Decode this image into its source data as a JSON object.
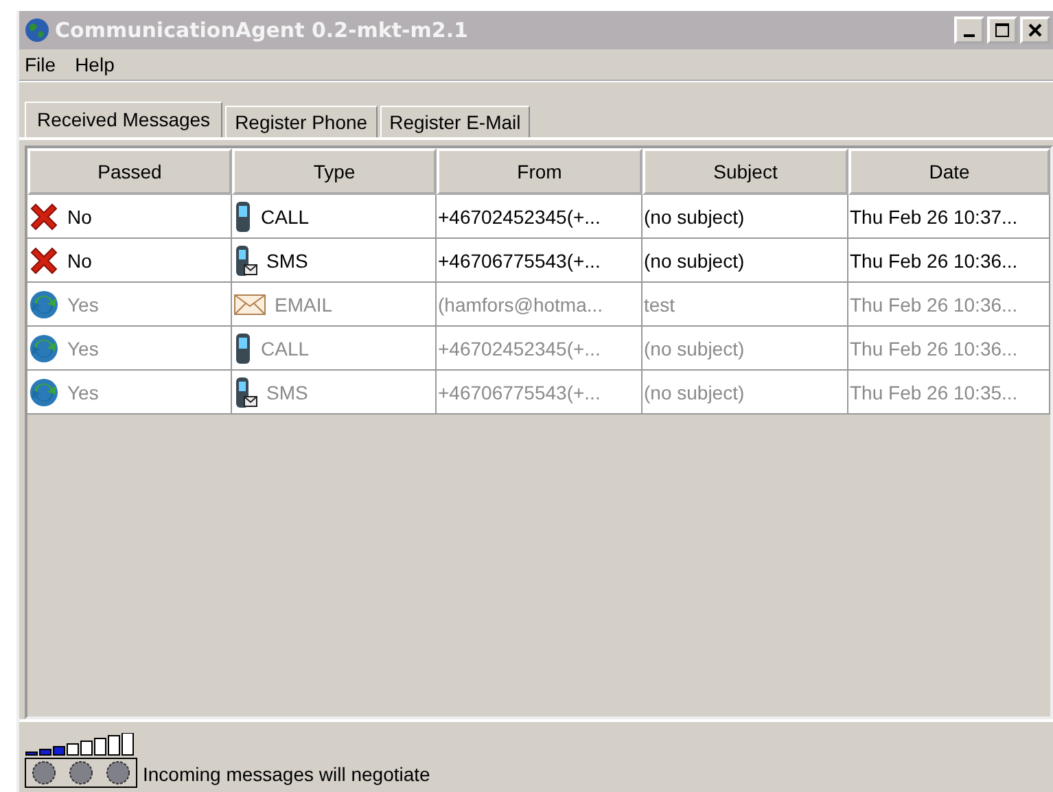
{
  "window": {
    "title": "CommunicationAgent 0.2-mkt-m2.1"
  },
  "menu": [
    "File",
    "Help"
  ],
  "tabs": [
    {
      "label": "Received Messages",
      "selected": true
    },
    {
      "label": "Register Phone",
      "selected": false
    },
    {
      "label": "Register E-Mail",
      "selected": false
    }
  ],
  "table": {
    "columns": [
      "Passed",
      "Type",
      "From",
      "Subject",
      "Date"
    ],
    "rows": [
      {
        "passed": false,
        "passed_text": "No",
        "kind": "call",
        "type": "CALL",
        "from": "+46702452345(+...",
        "subject": "(no subject)",
        "date": "Thu Feb 26 10:37..."
      },
      {
        "passed": false,
        "passed_text": "No",
        "kind": "sms",
        "type": "SMS",
        "from": "+46706775543(+...",
        "subject": "(no subject)",
        "date": "Thu Feb 26 10:36..."
      },
      {
        "passed": true,
        "passed_text": "Yes",
        "kind": "email",
        "type": "EMAIL",
        "from": "(hamfors@hotma...",
        "subject": "test",
        "date": "Thu Feb 26 10:36..."
      },
      {
        "passed": true,
        "passed_text": "Yes",
        "kind": "call",
        "type": "CALL",
        "from": "+46702452345(+...",
        "subject": "(no subject)",
        "date": "Thu Feb 26 10:36..."
      },
      {
        "passed": true,
        "passed_text": "Yes",
        "kind": "sms",
        "type": "SMS",
        "from": "+46706775543(+...",
        "subject": "(no subject)",
        "date": "Thu Feb 26 10:35..."
      }
    ]
  },
  "status_bar": {
    "text": "Incoming messages will negotiate"
  }
}
